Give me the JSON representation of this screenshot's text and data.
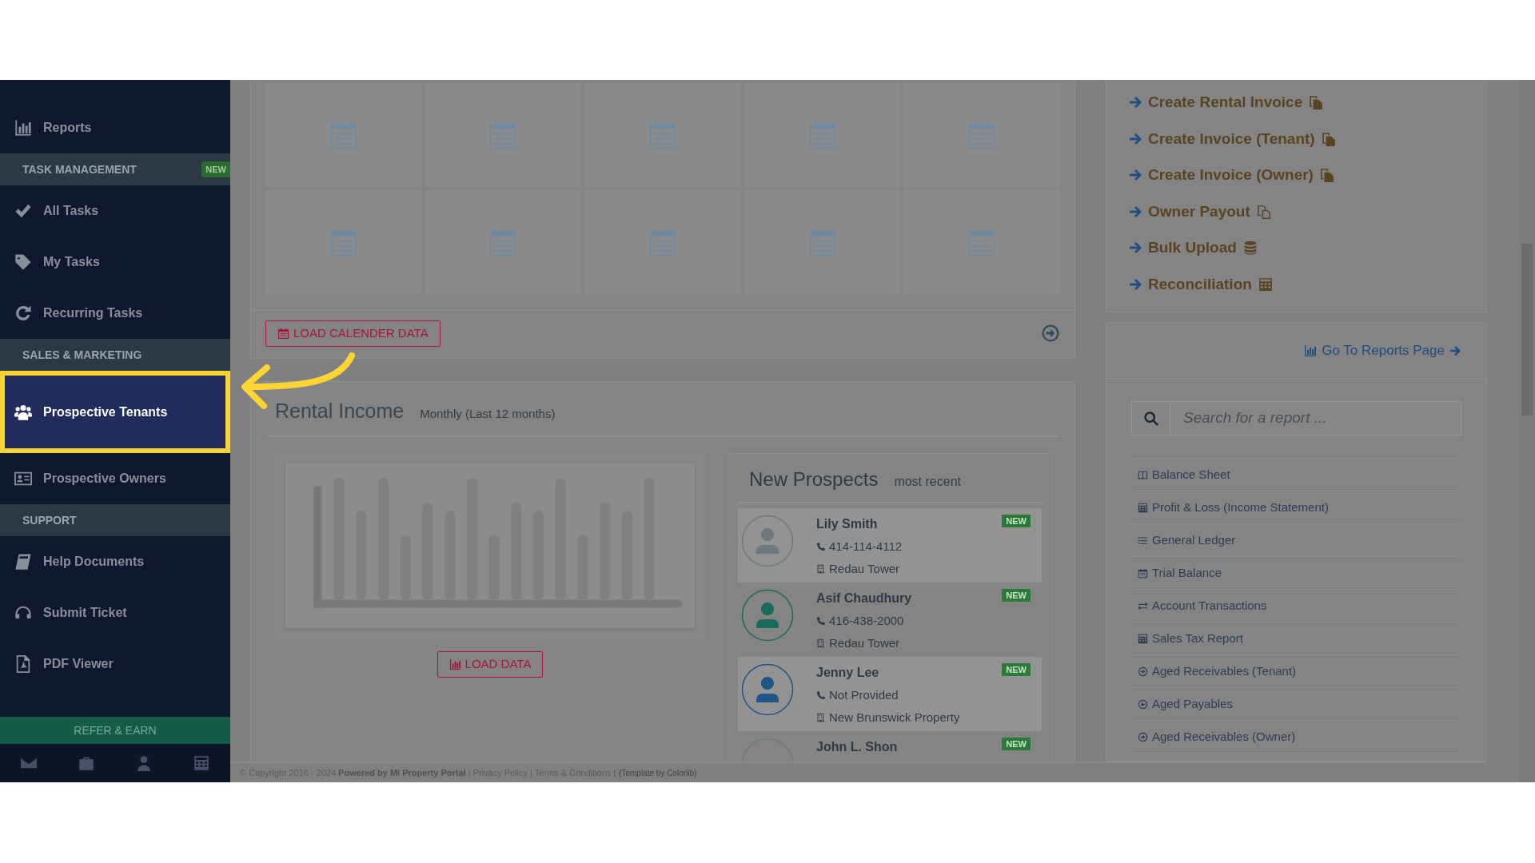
{
  "sidebar": {
    "items": [
      {
        "kind": "link",
        "label": "Reports",
        "selected": false
      },
      {
        "kind": "header",
        "label": "TASK MANAGEMENT",
        "badge": "NEW"
      },
      {
        "kind": "link",
        "label": "All Tasks",
        "selected": false
      },
      {
        "kind": "link",
        "label": "My Tasks",
        "selected": false
      },
      {
        "kind": "link",
        "label": "Recurring Tasks",
        "selected": false
      },
      {
        "kind": "header",
        "label": "SALES & MARKETING"
      },
      {
        "kind": "link",
        "label": "Prospective Tenants",
        "selected": true
      },
      {
        "kind": "link",
        "label": "Prospective Owners",
        "selected": false
      },
      {
        "kind": "header",
        "label": "SUPPORT"
      },
      {
        "kind": "link",
        "label": "Help Documents",
        "selected": false
      },
      {
        "kind": "link",
        "label": "Submit Ticket",
        "selected": false
      },
      {
        "kind": "link",
        "label": "PDF Viewer",
        "selected": false
      }
    ],
    "refer_button": "REFER & EARN"
  },
  "calendar": {
    "button": "LOAD CALENDER DATA"
  },
  "rental_income": {
    "title": "Rental Income",
    "subtitle": "Monthly (Last 12 months)",
    "button": "LOAD DATA"
  },
  "new_prospects": {
    "title": "New Prospects",
    "subtitle": "most recent",
    "items": [
      {
        "name": "Lily Smith",
        "badge": "NEW",
        "phone": "414-114-4112",
        "property": "Redau Tower",
        "color": "#6c7a80",
        "shaded": true
      },
      {
        "name": "Asif Chaudhury",
        "badge": "NEW",
        "phone": "416-438-2000",
        "property": "Redau Tower",
        "color": "#1a6b5a",
        "shaded": false
      },
      {
        "name": "Jenny Lee",
        "badge": "NEW",
        "phone": "Not Provided",
        "property": "New Brunswick Property",
        "color": "#1d5687",
        "shaded": true
      },
      {
        "name": "John L. Shon",
        "badge": "NEW",
        "shaded": false
      }
    ]
  },
  "quick_links": [
    "Create Rental Invoice",
    "Create Invoice (Tenant)",
    "Create Invoice (Owner)",
    "Owner Payout",
    "Bulk Upload",
    "Reconciliation"
  ],
  "reports_panel": {
    "link": "Go To Reports Page",
    "search": {
      "placeholder": "Search for a report ..."
    },
    "items": [
      "Balance Sheet",
      "Profit & Loss (Income Statement)",
      "General Ledger",
      "Trial Balance",
      "Account Transactions",
      "Sales Tax Report",
      "Aged Receivables (Tenant)",
      "Aged Payables",
      "Aged Receivables (Owner)"
    ]
  },
  "footer": {
    "text": "© Copyright 2016 - 2024 **Powered by MI Property Portal** | Privacy Policy | Terms & Conditions |",
    "credit": "(Template by Colorlib)"
  }
}
